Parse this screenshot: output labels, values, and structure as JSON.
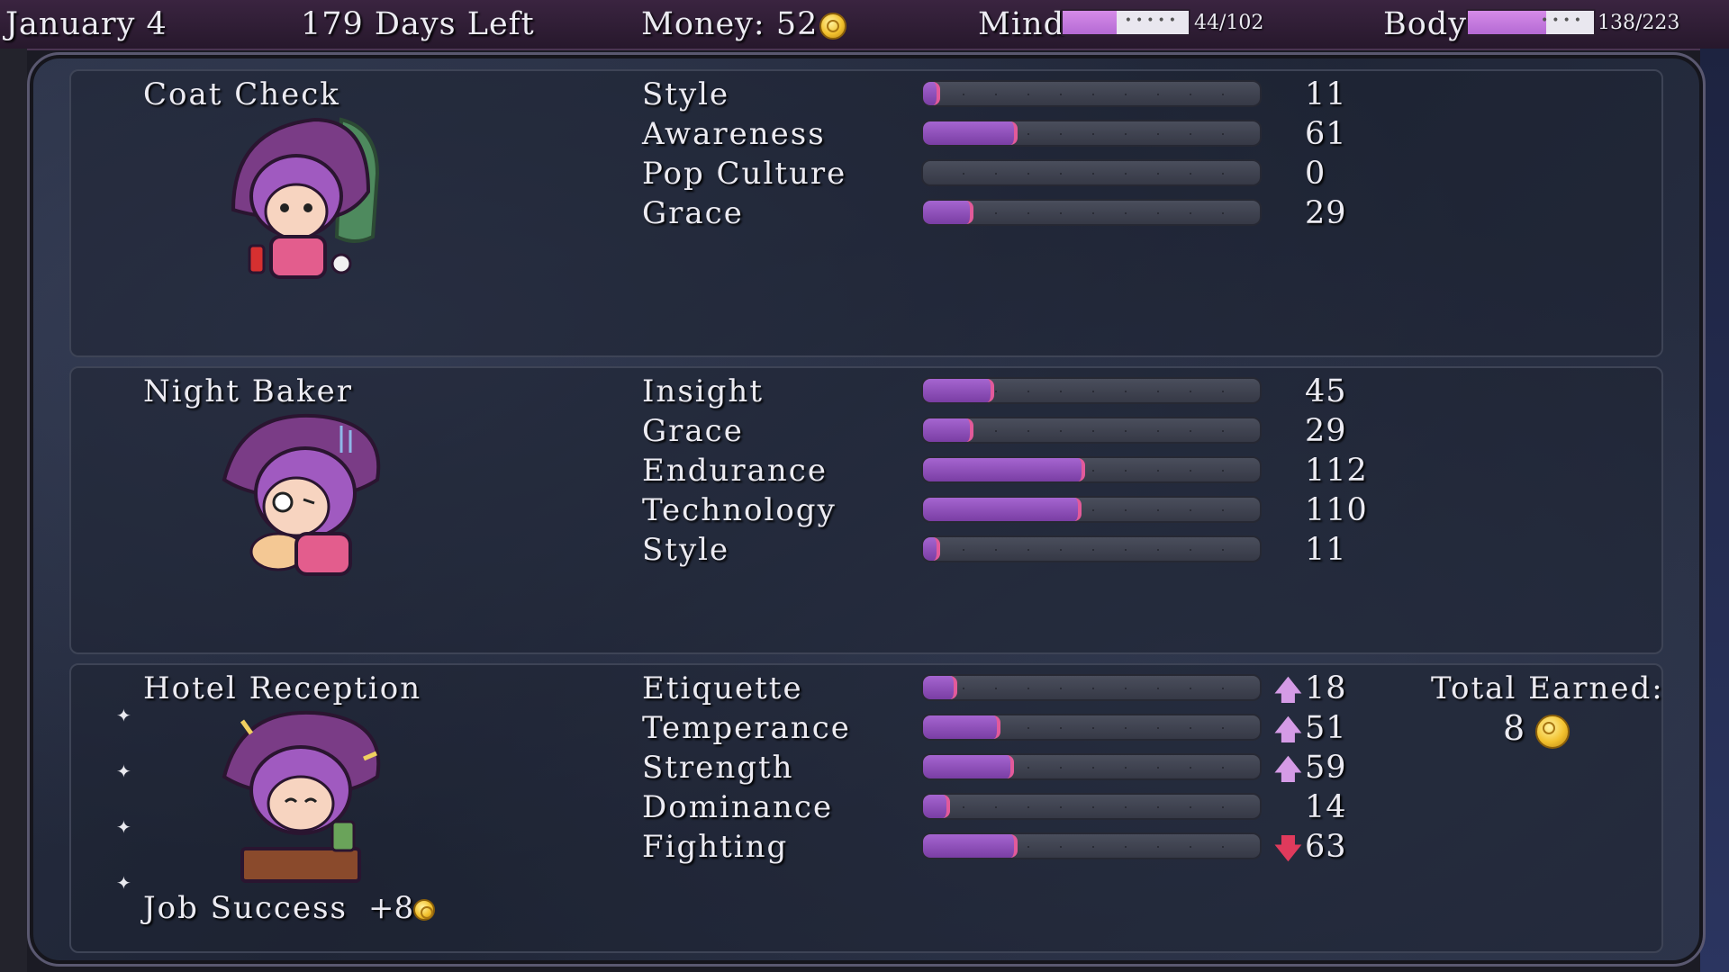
{
  "topbar": {
    "date": "January 4",
    "days_left": "179 Days Left",
    "money": "Money: 52",
    "mind_label": "Mind",
    "mind_value": "44/102",
    "mind_fraction": 0.43,
    "body_label": "Body",
    "body_value": "138/223",
    "body_fraction": 0.62
  },
  "jobs": [
    {
      "title": "Coat Check",
      "portrait_icon": "witch-holding-coat-icon",
      "stats": [
        {
          "name": "Style",
          "value": "11",
          "fill": 0.04
        },
        {
          "name": "Awareness",
          "value": "61",
          "fill": 0.27
        },
        {
          "name": "Pop Culture",
          "value": "0",
          "fill": 0.0
        },
        {
          "name": "Grace",
          "value": "29",
          "fill": 0.14
        }
      ]
    },
    {
      "title": "Night Baker",
      "portrait_icon": "witch-tired-baker-icon",
      "stats": [
        {
          "name": "Insight",
          "value": "45",
          "fill": 0.2
        },
        {
          "name": "Grace",
          "value": "29",
          "fill": 0.14
        },
        {
          "name": "Endurance",
          "value": "112",
          "fill": 0.47
        },
        {
          "name": "Technology",
          "value": "110",
          "fill": 0.46
        },
        {
          "name": "Style",
          "value": "11",
          "fill": 0.04
        }
      ]
    },
    {
      "title": "Hotel Reception",
      "portrait_icon": "witch-receptionist-icon",
      "stats": [
        {
          "name": "Etiquette",
          "value": "18",
          "fill": 0.09,
          "arrow": "up"
        },
        {
          "name": "Temperance",
          "value": "51",
          "fill": 0.22,
          "arrow": "up"
        },
        {
          "name": "Strength",
          "value": "59",
          "fill": 0.26,
          "arrow": "up"
        },
        {
          "name": "Dominance",
          "value": "14",
          "fill": 0.07
        },
        {
          "name": "Fighting",
          "value": "63",
          "fill": 0.27,
          "arrow": "down"
        }
      ],
      "total_earned_label": "Total Earned:",
      "total_earned_value": "8",
      "job_success_label": "Job Success",
      "job_success_value": "+8"
    }
  ],
  "arrows": {
    "up": "🡅",
    "down": "🡇"
  },
  "colors": {
    "accent": "#b56ad4",
    "bar_fill": "#8a48b6",
    "down_arrow": "#e03a5c",
    "up_arrow": "#d59be6"
  }
}
